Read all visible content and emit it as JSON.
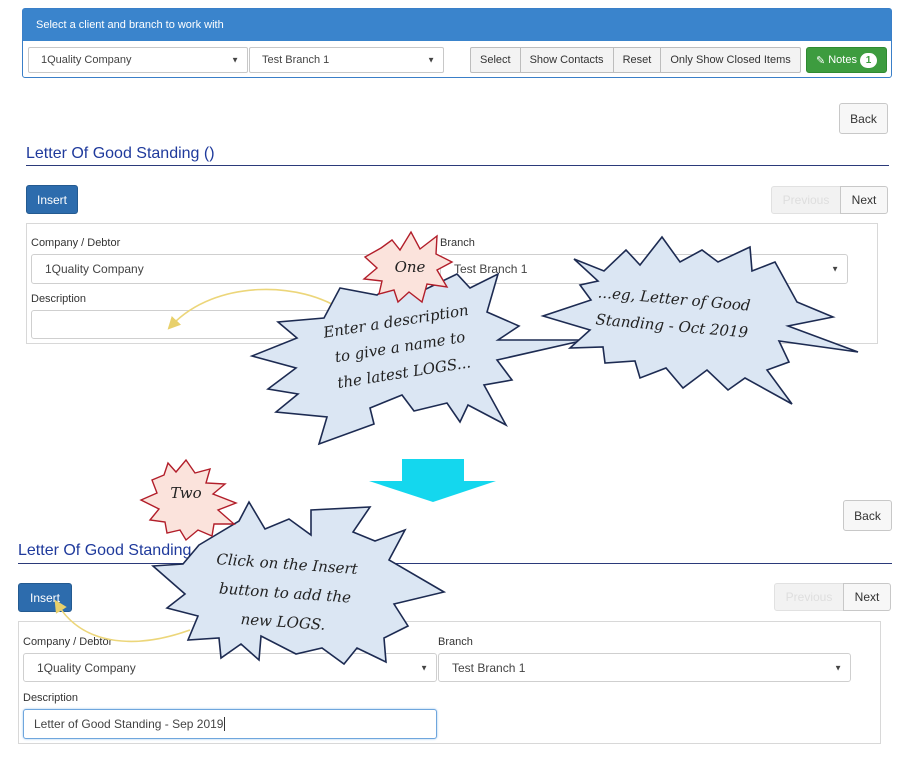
{
  "client_panel": {
    "header": "Select a client and branch to work with",
    "company_select": "1Quality Company",
    "branch_select": "Test Branch 1",
    "buttons": [
      "Select",
      "Show Contacts",
      "Reset",
      "Only Show Closed Items"
    ],
    "notes_label": "Notes",
    "notes_count": "1"
  },
  "top_form": {
    "back_label": "Back",
    "title": "Letter Of Good Standing ()",
    "insert_label": "Insert",
    "previous_label": "Previous",
    "next_label": "Next",
    "company_label": "Company / Debtor",
    "company_value": "1Quality Company",
    "branch_label": "Branch",
    "branch_value": "Test Branch 1",
    "description_label": "Description",
    "description_value": ""
  },
  "bottom_form": {
    "back_label": "Back",
    "title": "Letter Of Good Standing",
    "insert_label": "Insert",
    "previous_label": "Previous",
    "next_label": "Next",
    "company_label": "Company / Debtor",
    "company_value": "1Quality Company",
    "branch_label": "Branch",
    "branch_value": "Test Branch 1",
    "description_label": "Description",
    "description_value": "Letter of Good Standing - Sep 2019"
  },
  "callouts": {
    "one": "One",
    "step_one": [
      "Enter a description",
      "to give a name to",
      "the latest LOGS..."
    ],
    "example": [
      "...eg, Letter of Good",
      "Standing - Oct 2019"
    ],
    "two": "Two",
    "step_two": [
      "Click on the Insert",
      "button to add the",
      "new LOGS."
    ]
  },
  "colors": {
    "header_blue": "#3a84cc",
    "primary_button": "#2d6cad",
    "notes_green": "#3d9c3f",
    "title_blue": "#1f3a9c",
    "callout_fill": "#dbe6f3",
    "step_burst_fill": "#fbe3dc",
    "arrow_cyan": "#14d7ee"
  },
  "icons": {
    "notes": "pencil-icon",
    "select_caret": "chevron-down-icon",
    "flow_arrow": "arrow-down-icon"
  }
}
